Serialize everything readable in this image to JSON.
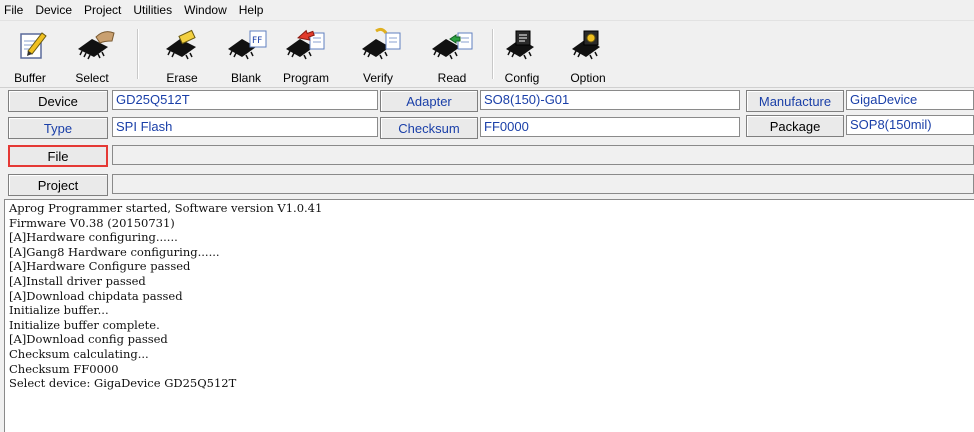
{
  "menu": [
    "File",
    "Device",
    "Project",
    "Utilities",
    "Window",
    "Help"
  ],
  "toolbar": {
    "buttons": [
      {
        "label": "Buffer",
        "icon": "notepad-pencil-icon"
      },
      {
        "label": "Select",
        "icon": "chip-hand-icon"
      },
      {
        "label": "Erase",
        "icon": "chip-eraser-icon"
      },
      {
        "label": "Blank",
        "icon": "chip-ff-icon"
      },
      {
        "label": "Program",
        "icon": "chip-arrow-program-icon"
      },
      {
        "label": "Verify",
        "icon": "chip-compare-icon"
      },
      {
        "label": "Read",
        "icon": "chip-read-arrow-icon"
      },
      {
        "label": "Config",
        "icon": "chip-config-icon"
      },
      {
        "label": "Option",
        "icon": "chip-option-icon"
      }
    ]
  },
  "device_info": {
    "device_label": "Device",
    "device_value": "GD25Q512T",
    "adapter_label": "Adapter",
    "adapter_value": "SO8(150)-G01",
    "manufacture_label": "Manufacture",
    "manufacture_value": "GigaDevice",
    "type_label": "Type",
    "type_value": "SPI Flash",
    "checksum_label": "Checksum",
    "checksum_value": "FF0000",
    "package_label": "Package",
    "package_value": "SOP8(150mil)",
    "file_label": "File",
    "file_value": "",
    "project_label": "Project",
    "project_value": ""
  },
  "log": [
    "Aprog Programmer started, Software version V1.0.41",
    "Firmware V0.38 (20150731)",
    "[A]Hardware configuring......",
    "[A]Gang8 Hardware configuring......",
    "[A]Hardware Configure passed",
    "[A]Install driver passed",
    "[A]Download chipdata passed",
    "Initialize buffer...",
    "Initialize buffer complete.",
    "[A]Download config passed",
    "Checksum calculating...",
    "Checksum FF0000",
    "Select device: GigaDevice GD25Q512T"
  ]
}
